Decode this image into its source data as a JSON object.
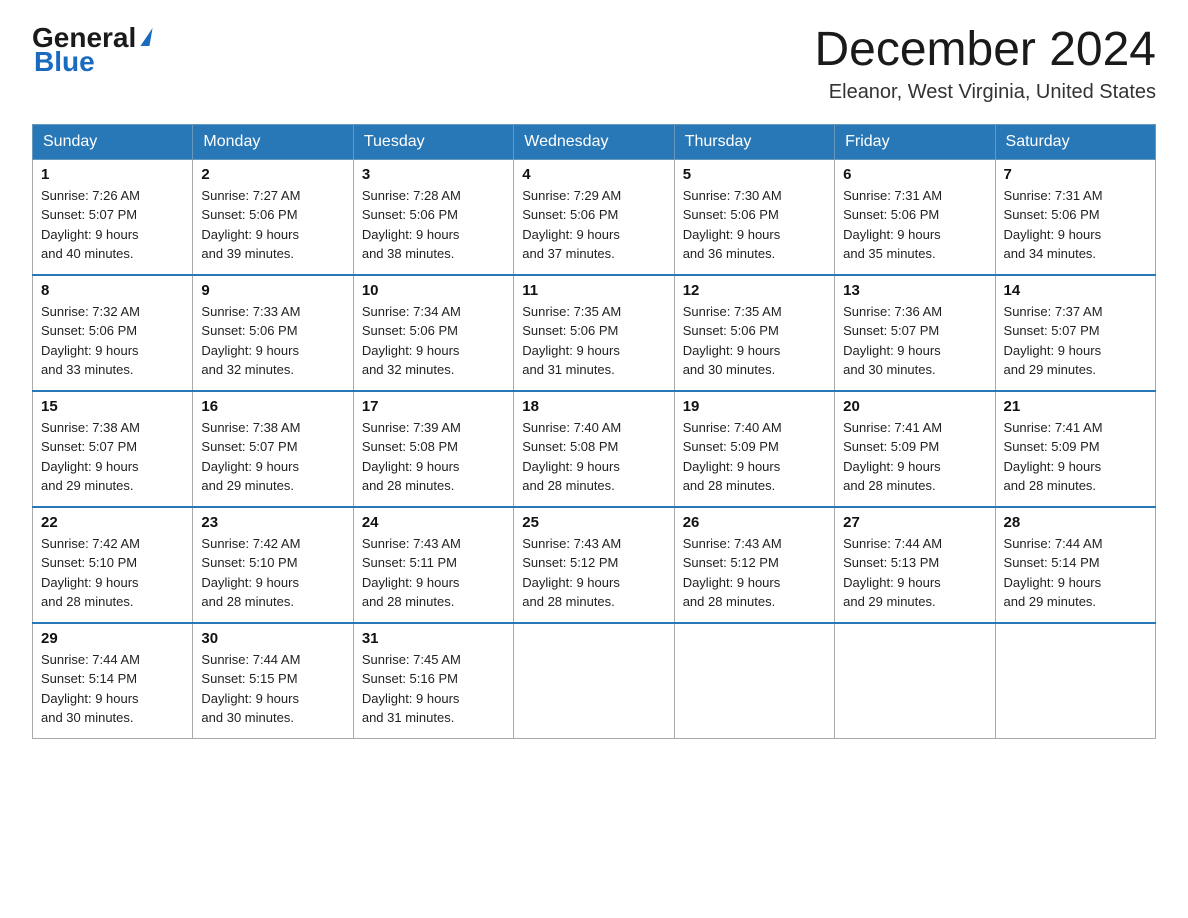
{
  "logo": {
    "general": "General",
    "blue": "Blue"
  },
  "header": {
    "month_title": "December 2024",
    "location": "Eleanor, West Virginia, United States"
  },
  "days_of_week": [
    "Sunday",
    "Monday",
    "Tuesday",
    "Wednesday",
    "Thursday",
    "Friday",
    "Saturday"
  ],
  "weeks": [
    [
      {
        "day": "1",
        "sunrise": "7:26 AM",
        "sunset": "5:07 PM",
        "daylight": "9 hours and 40 minutes."
      },
      {
        "day": "2",
        "sunrise": "7:27 AM",
        "sunset": "5:06 PM",
        "daylight": "9 hours and 39 minutes."
      },
      {
        "day": "3",
        "sunrise": "7:28 AM",
        "sunset": "5:06 PM",
        "daylight": "9 hours and 38 minutes."
      },
      {
        "day": "4",
        "sunrise": "7:29 AM",
        "sunset": "5:06 PM",
        "daylight": "9 hours and 37 minutes."
      },
      {
        "day": "5",
        "sunrise": "7:30 AM",
        "sunset": "5:06 PM",
        "daylight": "9 hours and 36 minutes."
      },
      {
        "day": "6",
        "sunrise": "7:31 AM",
        "sunset": "5:06 PM",
        "daylight": "9 hours and 35 minutes."
      },
      {
        "day": "7",
        "sunrise": "7:31 AM",
        "sunset": "5:06 PM",
        "daylight": "9 hours and 34 minutes."
      }
    ],
    [
      {
        "day": "8",
        "sunrise": "7:32 AM",
        "sunset": "5:06 PM",
        "daylight": "9 hours and 33 minutes."
      },
      {
        "day": "9",
        "sunrise": "7:33 AM",
        "sunset": "5:06 PM",
        "daylight": "9 hours and 32 minutes."
      },
      {
        "day": "10",
        "sunrise": "7:34 AM",
        "sunset": "5:06 PM",
        "daylight": "9 hours and 32 minutes."
      },
      {
        "day": "11",
        "sunrise": "7:35 AM",
        "sunset": "5:06 PM",
        "daylight": "9 hours and 31 minutes."
      },
      {
        "day": "12",
        "sunrise": "7:35 AM",
        "sunset": "5:06 PM",
        "daylight": "9 hours and 30 minutes."
      },
      {
        "day": "13",
        "sunrise": "7:36 AM",
        "sunset": "5:07 PM",
        "daylight": "9 hours and 30 minutes."
      },
      {
        "day": "14",
        "sunrise": "7:37 AM",
        "sunset": "5:07 PM",
        "daylight": "9 hours and 29 minutes."
      }
    ],
    [
      {
        "day": "15",
        "sunrise": "7:38 AM",
        "sunset": "5:07 PM",
        "daylight": "9 hours and 29 minutes."
      },
      {
        "day": "16",
        "sunrise": "7:38 AM",
        "sunset": "5:07 PM",
        "daylight": "9 hours and 29 minutes."
      },
      {
        "day": "17",
        "sunrise": "7:39 AM",
        "sunset": "5:08 PM",
        "daylight": "9 hours and 28 minutes."
      },
      {
        "day": "18",
        "sunrise": "7:40 AM",
        "sunset": "5:08 PM",
        "daylight": "9 hours and 28 minutes."
      },
      {
        "day": "19",
        "sunrise": "7:40 AM",
        "sunset": "5:09 PM",
        "daylight": "9 hours and 28 minutes."
      },
      {
        "day": "20",
        "sunrise": "7:41 AM",
        "sunset": "5:09 PM",
        "daylight": "9 hours and 28 minutes."
      },
      {
        "day": "21",
        "sunrise": "7:41 AM",
        "sunset": "5:09 PM",
        "daylight": "9 hours and 28 minutes."
      }
    ],
    [
      {
        "day": "22",
        "sunrise": "7:42 AM",
        "sunset": "5:10 PM",
        "daylight": "9 hours and 28 minutes."
      },
      {
        "day": "23",
        "sunrise": "7:42 AM",
        "sunset": "5:10 PM",
        "daylight": "9 hours and 28 minutes."
      },
      {
        "day": "24",
        "sunrise": "7:43 AM",
        "sunset": "5:11 PM",
        "daylight": "9 hours and 28 minutes."
      },
      {
        "day": "25",
        "sunrise": "7:43 AM",
        "sunset": "5:12 PM",
        "daylight": "9 hours and 28 minutes."
      },
      {
        "day": "26",
        "sunrise": "7:43 AM",
        "sunset": "5:12 PM",
        "daylight": "9 hours and 28 minutes."
      },
      {
        "day": "27",
        "sunrise": "7:44 AM",
        "sunset": "5:13 PM",
        "daylight": "9 hours and 29 minutes."
      },
      {
        "day": "28",
        "sunrise": "7:44 AM",
        "sunset": "5:14 PM",
        "daylight": "9 hours and 29 minutes."
      }
    ],
    [
      {
        "day": "29",
        "sunrise": "7:44 AM",
        "sunset": "5:14 PM",
        "daylight": "9 hours and 30 minutes."
      },
      {
        "day": "30",
        "sunrise": "7:44 AM",
        "sunset": "5:15 PM",
        "daylight": "9 hours and 30 minutes."
      },
      {
        "day": "31",
        "sunrise": "7:45 AM",
        "sunset": "5:16 PM",
        "daylight": "9 hours and 31 minutes."
      },
      null,
      null,
      null,
      null
    ]
  ],
  "labels": {
    "sunrise": "Sunrise:",
    "sunset": "Sunset:",
    "daylight": "Daylight:"
  }
}
